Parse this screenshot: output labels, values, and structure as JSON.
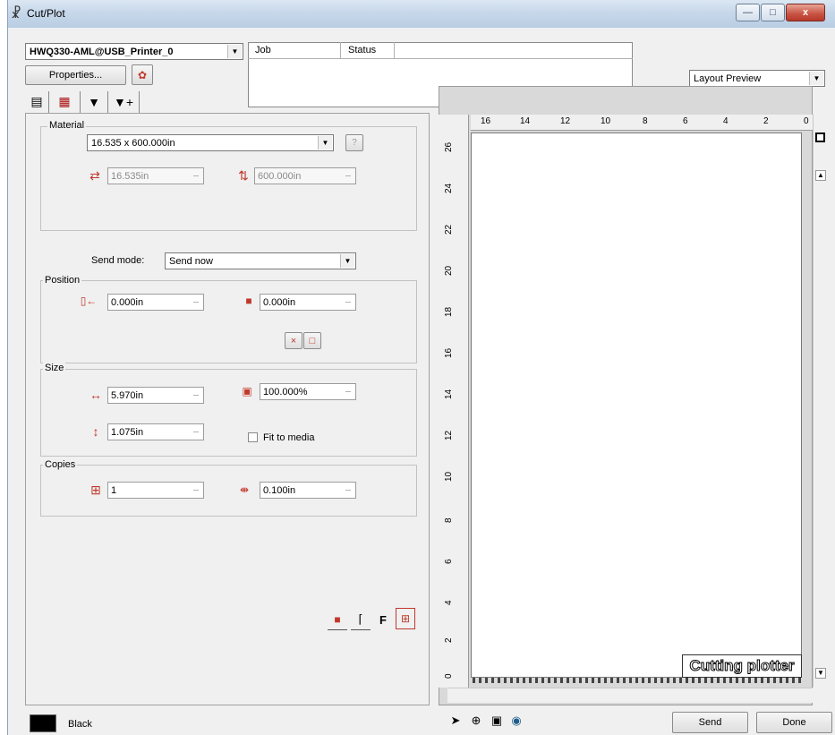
{
  "window": {
    "title": "Cut/Plot",
    "title_icon": "plotter-knife-icon",
    "controls": {
      "minimize": "—",
      "maximize": "□",
      "close": "x"
    }
  },
  "printer": {
    "selected": "HWQ330-AML@USB_Printer_0"
  },
  "properties_button": "Properties...",
  "job_table": {
    "columns": [
      "Job",
      "Status"
    ]
  },
  "preview_mode": {
    "selected": "Layout Preview"
  },
  "material": {
    "label": "Material",
    "size": "16.535 x 600.000in",
    "width": "16.535in",
    "length": "600.000in"
  },
  "send_mode": {
    "label": "Send mode:",
    "value": "Send now"
  },
  "position": {
    "label": "Position",
    "x": "0.000in",
    "y": "0.000in"
  },
  "size": {
    "label": "Size",
    "width": "5.970in",
    "scale": "100.000%",
    "height": "1.075in",
    "fit_to_media": "Fit to media",
    "fit_checked": false
  },
  "copies": {
    "label": "Copies",
    "count": "1",
    "spacing": "0.100in"
  },
  "options_letter": "F",
  "ruler": {
    "horizontal": [
      "16",
      "14",
      "12",
      "10",
      "8",
      "6",
      "4",
      "2",
      "0"
    ],
    "vertical": [
      "26",
      "24",
      "22",
      "20",
      "18",
      "16",
      "14",
      "12",
      "10",
      "8",
      "6",
      "4",
      "2",
      "0"
    ]
  },
  "preview_label": "Cutting plotter",
  "color_name": "Black",
  "color_swatch": "#000000",
  "footer": {
    "send": "Send",
    "done": "Done"
  }
}
